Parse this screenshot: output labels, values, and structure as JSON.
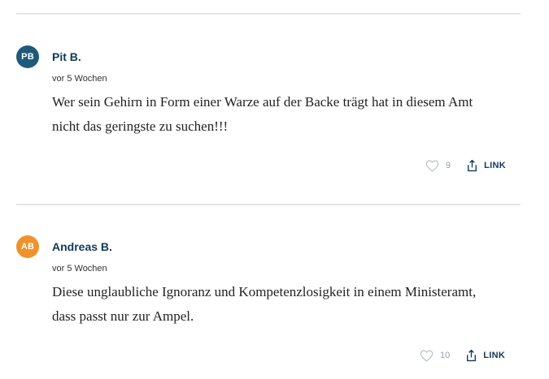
{
  "comments": [
    {
      "initials": "PB",
      "avatar_color": "#1f5a7a",
      "author": "Pit B.",
      "time": "vor 5 Wochen",
      "text": "Wer sein Gehirn in Form einer Warze auf der Backe trägt hat in diesem Amt nicht das geringste zu suchen!!!",
      "likes": "9",
      "link_label": "LINK",
      "like_icon": "heart-outline-icon",
      "link_icon": "share-icon"
    },
    {
      "initials": "AB",
      "avatar_color": "#f0922b",
      "author": "Andreas B.",
      "time": "vor 5 Wochen",
      "text": "Diese unglaubliche Ignoranz und Kompetenzlosigkeit in einem Ministeramt, dass passt nur zur Ampel.",
      "likes": "10",
      "link_label": "LINK",
      "like_icon": "heart-outline-icon",
      "link_icon": "share-icon"
    }
  ]
}
